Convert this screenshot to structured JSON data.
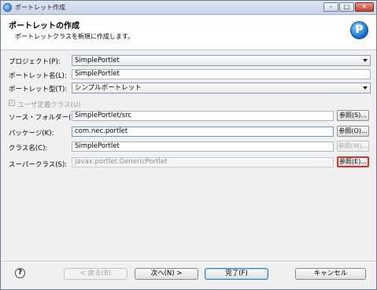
{
  "window": {
    "title": "ポートレット作成"
  },
  "banner": {
    "title": "ポートレットの作成",
    "description": "ポートレットクラスを新規に作成します。",
    "logo_letter": "P"
  },
  "form": {
    "project_label": "プロジェクト(P):",
    "project_value": "SimplePortlet",
    "portlet_name_label": "ポートレット名(L):",
    "portlet_name_value": "SimplePortlet",
    "portlet_type_label": "ポートレット型(T):",
    "portlet_type_value": "シンプルポートレット",
    "user_class_label": "ユーザ定義クラス(U)",
    "user_class_check": "✓",
    "source_folder_label": "ソース・フォルダー(D):",
    "source_folder_value": "SimplePortlet/src",
    "package_label": "パッケージ(K):",
    "package_value": "com.nec.portlet",
    "class_name_label": "クラス名(C):",
    "class_name_value": "SimplePortlet",
    "superclass_label": "スーパークラス(S):",
    "superclass_value": "javax.portlet.GenericPortlet",
    "browse_source": "参照(S)...",
    "browse_package": "参照(O)...",
    "browse_class": "参照(W)...",
    "browse_superclass": "参照(E)..."
  },
  "footer": {
    "help": "?",
    "back": "< 戻る(B)",
    "next": "次へ(N) >",
    "finish": "完了(F)",
    "cancel": "キャンセル"
  },
  "titlebar_buttons": {
    "minimize": "–",
    "maximize": "□",
    "close": "✕"
  }
}
